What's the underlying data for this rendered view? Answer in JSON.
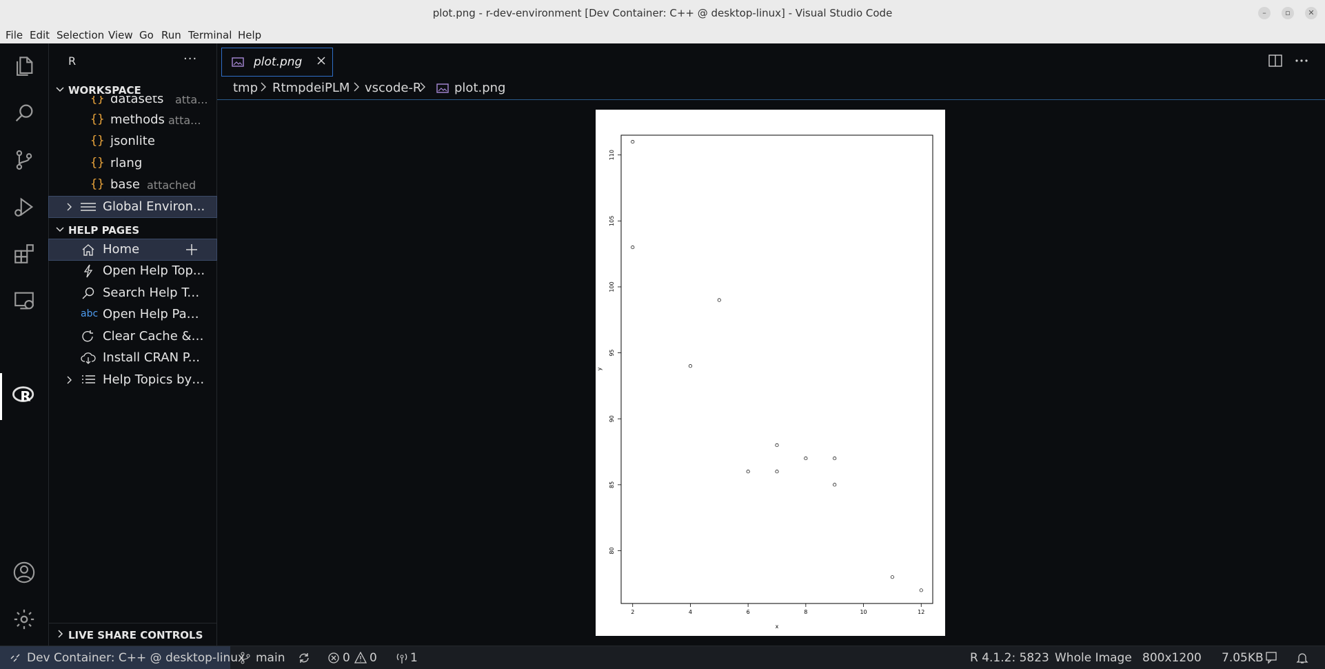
{
  "window": {
    "title": "plot.png - r-dev-environment [Dev Container: C++ @ desktop-linux] - Visual Studio Code"
  },
  "menu": [
    "File",
    "Edit",
    "Selection",
    "View",
    "Go",
    "Run",
    "Terminal",
    "Help"
  ],
  "activity_bar": [
    "explorer-icon",
    "search-icon",
    "source-control-icon",
    "run-debug-icon",
    "extensions-icon",
    "remote-explorer-icon",
    "r-icon",
    "accounts-icon",
    "settings-gear-icon"
  ],
  "sidebar": {
    "title": "R",
    "more": "···",
    "workspace": {
      "header": "WORKSPACE",
      "items": [
        {
          "name": "datasets",
          "desc": "atta..."
        },
        {
          "name": "methods",
          "desc": "atta..."
        },
        {
          "name": "jsonlite",
          "desc": ""
        },
        {
          "name": "rlang",
          "desc": ""
        },
        {
          "name": "base",
          "desc": "attached"
        }
      ],
      "global_env": "Global Environ..."
    },
    "help": {
      "header": "HELP PAGES",
      "items": [
        {
          "icon": "home-icon",
          "label": "Home"
        },
        {
          "icon": "lightning-icon",
          "label": "Open Help Top..."
        },
        {
          "icon": "search-icon",
          "label": "Search Help To..."
        },
        {
          "icon": "abc-icon",
          "label": "Open Help Pag..."
        },
        {
          "icon": "refresh-icon",
          "label": "Clear Cache & ..."
        },
        {
          "icon": "cloud-download-icon",
          "label": "Install CRAN P..."
        },
        {
          "icon": "list-icon",
          "label": "Help Topics by ..."
        }
      ],
      "abc_text": "abc"
    },
    "live_share": "LIVE SHARE CONTROLS"
  },
  "editor": {
    "tab_label": "plot.png",
    "breadcrumbs": [
      "tmp",
      "RtmpdeiPLM",
      "vscode-R",
      "plot.png"
    ]
  },
  "chart_data": {
    "type": "scatter",
    "xlabel": "x",
    "ylabel": "y",
    "xlim": [
      1.6,
      12.4
    ],
    "ylim": [
      76,
      111.5
    ],
    "xticks": [
      2,
      4,
      6,
      8,
      10,
      12
    ],
    "yticks": [
      80,
      85,
      90,
      95,
      100,
      105,
      110
    ],
    "x": [
      2,
      2,
      4,
      5,
      6,
      7,
      7,
      8,
      9,
      9,
      11,
      12
    ],
    "y": [
      111,
      103,
      94,
      99,
      86,
      88,
      86,
      87,
      87,
      85,
      78,
      77
    ]
  },
  "status": {
    "remote": "Dev Container: C++ @ desktop-linux",
    "branch": "main",
    "errors": "0",
    "warnings": "0",
    "ports": "1",
    "r_version": "R 4.1.2: 5823",
    "zoom": "Whole Image",
    "dimensions": "800x1200",
    "size": "7.05KB"
  }
}
